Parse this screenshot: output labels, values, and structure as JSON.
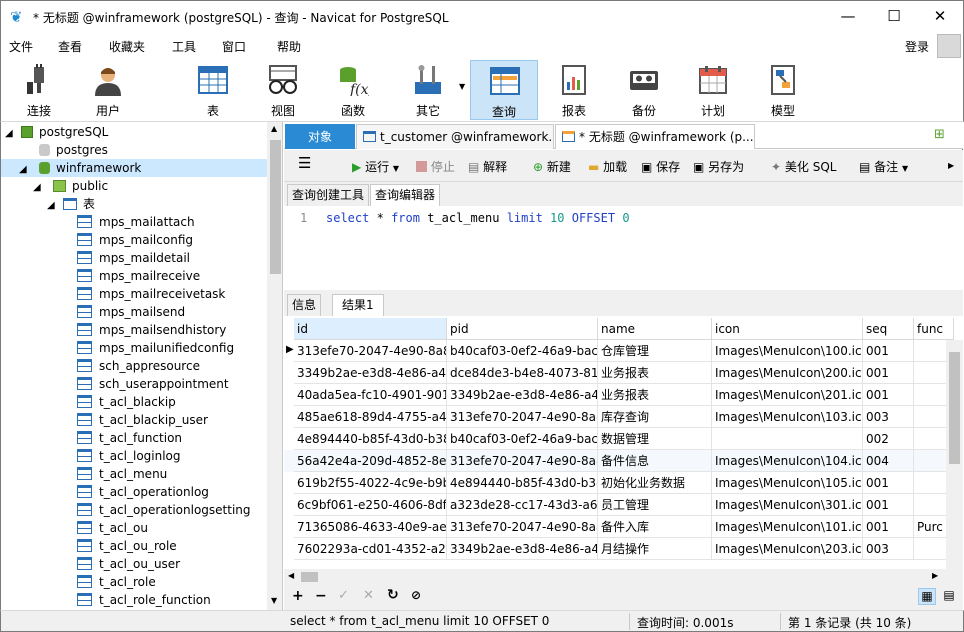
{
  "window": {
    "title": "* 无标题 @winframework (postgreSQL) - 查询 - Navicat for PostgreSQL"
  },
  "menu": [
    "文件",
    "查看",
    "收藏夹",
    "工具",
    "窗口",
    "帮助"
  ],
  "login_label": "登录",
  "toolbar": {
    "connect": "连接",
    "user": "用户",
    "table": "表",
    "view": "视图",
    "function": "函数",
    "other": "其它",
    "query": "查询",
    "report": "报表",
    "backup": "备份",
    "schedule": "计划",
    "model": "模型"
  },
  "tree": {
    "connection": "postgreSQL",
    "db_postgres": "postgres",
    "db_winframework": "winframework",
    "schema": "public",
    "tables_node": "表",
    "tables": [
      "mps_mailattach",
      "mps_mailconfig",
      "mps_maildetail",
      "mps_mailreceive",
      "mps_mailreceivetask",
      "mps_mailsend",
      "mps_mailsendhistory",
      "mps_mailunifiedconfig",
      "sch_appresource",
      "sch_userappointment",
      "t_acl_blackip",
      "t_acl_blackip_user",
      "t_acl_function",
      "t_acl_loginlog",
      "t_acl_menu",
      "t_acl_operationlog",
      "t_acl_operationlogsetting",
      "t_acl_ou",
      "t_acl_ou_role",
      "t_acl_ou_user",
      "t_acl_role",
      "t_acl_role_function"
    ]
  },
  "tabs": {
    "objects": "对象",
    "tab1": "t_customer @winframework...",
    "tab2": "* 无标题 @winframework (p..."
  },
  "query_toolbar": {
    "run": "运行",
    "stop": "停止",
    "explain": "解释",
    "new": "新建",
    "load": "加载",
    "save": "保存",
    "save_as": "另存为",
    "beautify": "美化 SQL",
    "note": "备注"
  },
  "editor_tabs": {
    "builder": "查询创建工具",
    "editor": "查询编辑器"
  },
  "editor": {
    "line": "1",
    "sql": "select * from t_acl_menu limit 10 OFFSET 0"
  },
  "result_tabs": {
    "info": "信息",
    "result1": "结果1"
  },
  "grid": {
    "columns": [
      "id",
      "pid",
      "name",
      "icon",
      "seq",
      "func"
    ],
    "rows": [
      [
        "313efe70-2047-4e90-8a8e",
        "b40caf03-0ef2-46a9-bac0",
        "仓库管理",
        "Images\\MenuIcon\\100.ico",
        "001",
        ""
      ],
      [
        "3349b2ae-e3d8-4e86-a4c",
        "dce84de3-b4e8-4073-812",
        "业务报表",
        "Images\\MenuIcon\\200.ico",
        "001",
        ""
      ],
      [
        "40ada5ea-fc10-4901-901e",
        "3349b2ae-e3d8-4e86-a4c",
        "业务报表",
        "Images\\MenuIcon\\201.ico",
        "001",
        ""
      ],
      [
        "485ae618-89d4-4755-a4e",
        "313efe70-2047-4e90-8a8e",
        "库存查询",
        "Images\\MenuIcon\\103.ico",
        "003",
        ""
      ],
      [
        "4e894440-b85f-43d0-b38",
        "b40caf03-0ef2-46a9-bac0",
        "数据管理",
        "",
        "002",
        ""
      ],
      [
        "56a42e4a-209d-4852-8ec",
        "313efe70-2047-4e90-8a8e",
        "备件信息",
        "Images\\MenuIcon\\104.ico",
        "004",
        ""
      ],
      [
        "619b2f55-4022-4c9e-b9b",
        "4e894440-b85f-43d0-b38",
        "初始化业务数据",
        "Images\\MenuIcon\\105.ico",
        "001",
        ""
      ],
      [
        "6c9bf061-e250-4606-8dfa",
        "a323de28-cc17-43d3-a60",
        "员工管理",
        "Images\\MenuIcon\\301.ico",
        "001",
        ""
      ],
      [
        "71365086-4633-40e9-aec",
        "313efe70-2047-4e90-8a8e",
        "备件入库",
        "Images\\MenuIcon\\101.ico",
        "001",
        "Purc"
      ],
      [
        "7602293a-cd01-4352-a2d",
        "3349b2ae-e3d8-4e86-a4c",
        "月结操作",
        "Images\\MenuIcon\\203.ico",
        "003",
        ""
      ]
    ]
  },
  "status": {
    "sql": "select * from t_acl_menu limit 10 OFFSET 0",
    "time": "查询时间: 0.001s",
    "records": "第 1 条记录 (共 10 条)"
  }
}
